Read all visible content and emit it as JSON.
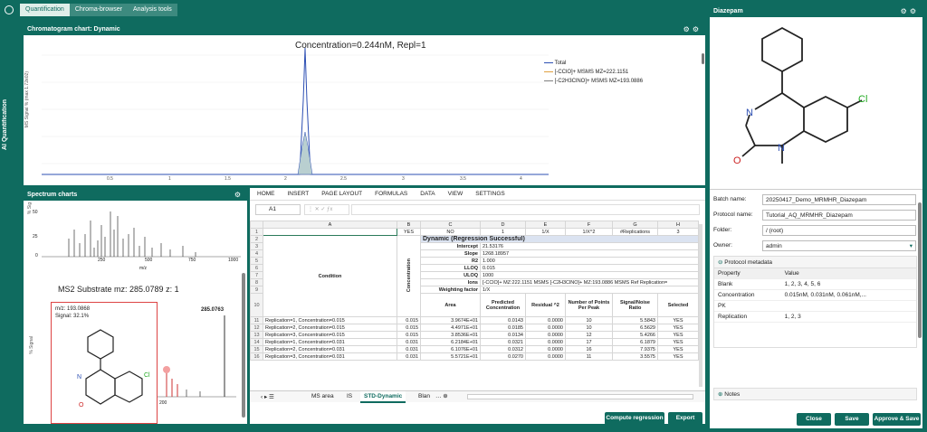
{
  "tabs": [
    "Quantification",
    "Chroma-browser",
    "Analysis tools"
  ],
  "side_label": "AI Quantification",
  "chrom": {
    "title": "Chromatogram chart: Dynamic",
    "plot_title": "Concentration=0.244nM, Repl=1",
    "ylabel": "MS Signal % (max 1.72e02)",
    "xticks": [
      "0.5",
      "1",
      "1.5",
      "2",
      "2.5",
      "3",
      "3.5",
      "4"
    ],
    "legend": [
      "Total",
      "[-CClO]+ MSMS MZ=222.1151",
      "[-C2H3ClNO]+ MSMS MZ=193.0886"
    ]
  },
  "spectrum": {
    "title": "Spectrum charts",
    "ylabel1": "% Sig",
    "yticks1": [
      "50",
      "25",
      "0"
    ],
    "xticks1": [
      "250",
      "500",
      "750",
      "1000"
    ],
    "xlabel1": "m/z",
    "title2": "MS2 Substrate mz: 285.0789 z: 1",
    "peak_label": "285.0763",
    "ylabel2": "% Signal",
    "xtick2": "200",
    "tooltip": {
      "mz": "m/z: 193.0868",
      "signal": "Signal: 32.1%"
    }
  },
  "ribbon": [
    "HOME",
    "INSERT",
    "PAGE LAYOUT",
    "FORMULAS",
    "DATA",
    "VIEW",
    "SETTINGS"
  ],
  "cellref": "A1",
  "cols": [
    "A",
    "B",
    "C",
    "D",
    "E",
    "F",
    "G",
    "H"
  ],
  "row1": [
    "",
    "YES",
    "NO",
    "1",
    "1/X",
    "1/X^2",
    "#Replications",
    "3"
  ],
  "reg_title": "Dynamic (Regression Successful)",
  "condition": "Condition",
  "concentration": "Concentration",
  "params": [
    [
      "Intercept",
      "21.53176"
    ],
    [
      "Slope",
      "1268.18957"
    ],
    [
      "R2",
      "1.000"
    ],
    [
      "LLOQ",
      "0.015"
    ],
    [
      "ULOQ",
      "1000"
    ],
    [
      "Ions",
      "[-CClO]+ MZ:222.1151 MSMS [-C2H3ClNO]+ MZ:193.0886 MSMS Ref Replication="
    ],
    [
      "Weighting factor",
      "1/X"
    ]
  ],
  "heads": [
    "Area",
    "Predicted Concentration",
    "Residual ^2",
    "Number of Points Per Peak",
    "Signal/Noise Ratio",
    "Selected"
  ],
  "rows": [
    [
      "11",
      "Replication=1, Concentration=0.015",
      "0.015",
      "3.9674E+01",
      "0.0143",
      "0.0000",
      "10",
      "5.5843",
      "YES"
    ],
    [
      "12",
      "Replication=2, Concentration=0.015",
      "0.015",
      "4.4971E+01",
      "0.0185",
      "0.0000",
      "10",
      "6.5629",
      "YES"
    ],
    [
      "13",
      "Replication=3, Concentration=0.015",
      "0.015",
      "3.8536E+01",
      "0.0134",
      "0.0000",
      "12",
      "5.4266",
      "YES"
    ],
    [
      "14",
      "Replication=1, Concentration=0.031",
      "0.031",
      "6.2184E+01",
      "0.0321",
      "0.0000",
      "17",
      "6.1879",
      "YES"
    ],
    [
      "15",
      "Replication=2, Concentration=0.031",
      "0.031",
      "6.1076E+01",
      "0.0312",
      "0.0000",
      "16",
      "7.9375",
      "YES"
    ],
    [
      "16",
      "Replication=3, Concentration=0.031",
      "0.031",
      "5.5721E+01",
      "0.0270",
      "0.0000",
      "11",
      "3.5575",
      "YES"
    ]
  ],
  "sheets": [
    "MS area",
    "IS",
    "STD-Dynamic",
    "Blan"
  ],
  "actions": {
    "compute": "Compute regression",
    "export": "Export"
  },
  "right": {
    "title": "Diazepam",
    "labels": {
      "batch": "Batch name:",
      "protocol": "Protocol name:",
      "folder": "Folder:",
      "owner": "Owner:"
    },
    "values": {
      "batch": "20250417_Demo_MRMHR_Diazepam",
      "protocol": "Tutorial_AQ_MRMHR_Diazepam",
      "folder": "/ (root)",
      "owner": "admin"
    },
    "metadata_title": "Protocol metadata",
    "meta_head": [
      "Property",
      "Value"
    ],
    "meta": [
      [
        "Blank",
        "1, 2, 3, 4, 5, 6"
      ],
      [
        "Concentration",
        "0.015nM, 0.031nM, 0.061nM,..."
      ],
      [
        "PK",
        ""
      ],
      [
        "Replication",
        "1, 2, 3"
      ]
    ],
    "notes": "Notes",
    "buttons": [
      "Close",
      "Save",
      "Approve & Save"
    ]
  },
  "colors": {
    "brand": "#0f6b5f",
    "total": "#2d4fb3",
    "ion1": "#e0a040",
    "ion2": "#808080"
  }
}
